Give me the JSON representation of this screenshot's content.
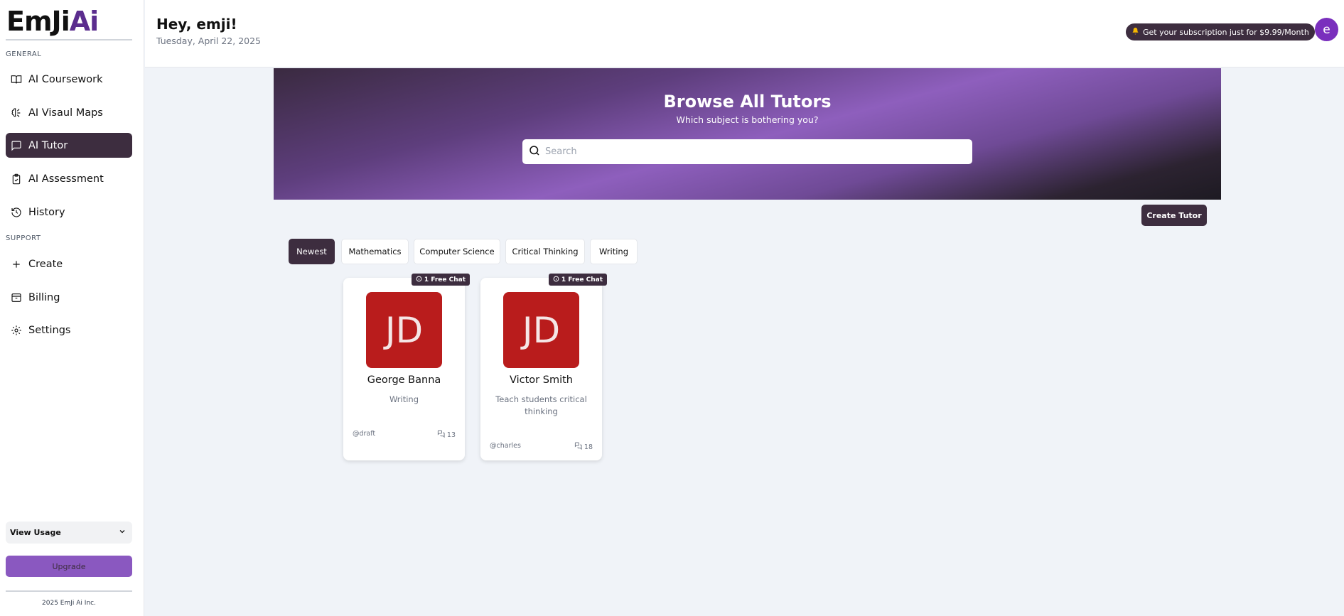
{
  "sidebar": {
    "logo_main": "EmJi",
    "logo_accent": "Ai",
    "general_label": "GENERAL",
    "support_label": "SUPPORT",
    "items": [
      {
        "label": "AI Coursework",
        "icon": "book-open-icon"
      },
      {
        "label": "AI Visaul Maps",
        "icon": "brain-icon"
      },
      {
        "label": "AI Tutor",
        "icon": "message-square-icon"
      },
      {
        "label": "AI Assessment",
        "icon": "clipboard-check-icon"
      },
      {
        "label": "History",
        "icon": "history-icon"
      }
    ],
    "support_items": [
      {
        "label": "Create",
        "icon": "plus-icon"
      },
      {
        "label": "Billing",
        "icon": "archive-icon"
      },
      {
        "label": "Settings",
        "icon": "gear-icon"
      }
    ],
    "view_usage": "View Usage",
    "upgrade": "Upgrade",
    "copyright": "2025 EmJi Ai Inc."
  },
  "header": {
    "greeting": "Hey, emji!",
    "date": "Tuesday, April 22, 2025",
    "promo": "Get your subscription just for $9.99/Month",
    "avatar_initial": "e"
  },
  "banner": {
    "title": "Browse All Tutors",
    "subtitle": "Which subject is bothering you?",
    "search_placeholder": "Search"
  },
  "create_tutor": "Create Tutor",
  "filters": [
    "Newest",
    "Mathematics",
    "Computer Science",
    "Critical Thinking",
    "Writing"
  ],
  "tutors": [
    {
      "initials": "JD",
      "name": "George Banna",
      "description": "Writing",
      "handle": "@draft",
      "chats": "13",
      "badge": "1 Free Chat"
    },
    {
      "initials": "JD",
      "name": "Victor Smith",
      "description": "Teach students critical thinking",
      "handle": "@charles",
      "chats": "18",
      "badge": "1 Free Chat"
    }
  ],
  "colors": {
    "accent_dark": "#3d2d3f",
    "brand_purple": "#5b2d8e",
    "upgrade_purple": "#8a58c0",
    "avatar_red": "#b91c1c"
  }
}
